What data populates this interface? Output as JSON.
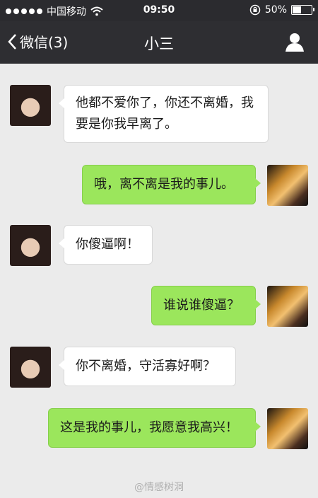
{
  "status": {
    "carrier": "中国移动",
    "time": "09:50",
    "battery": "50%",
    "battery_level": 0.5
  },
  "nav": {
    "back_label": "微信(3)",
    "title": "小三"
  },
  "messages": [
    {
      "side": "left",
      "text": "他都不爱你了，你还不离婚，我要是你我早离了。"
    },
    {
      "side": "right",
      "text": "哦，离不离是我的事儿。"
    },
    {
      "side": "left",
      "text": "你傻逼啊！"
    },
    {
      "side": "right",
      "text": "谁说谁傻逼？"
    },
    {
      "side": "left",
      "text": "你不离婚，守活寡好啊？"
    },
    {
      "side": "right",
      "text": "这是我的事儿，我愿意我高兴！"
    }
  ],
  "watermark": "@情感树洞"
}
